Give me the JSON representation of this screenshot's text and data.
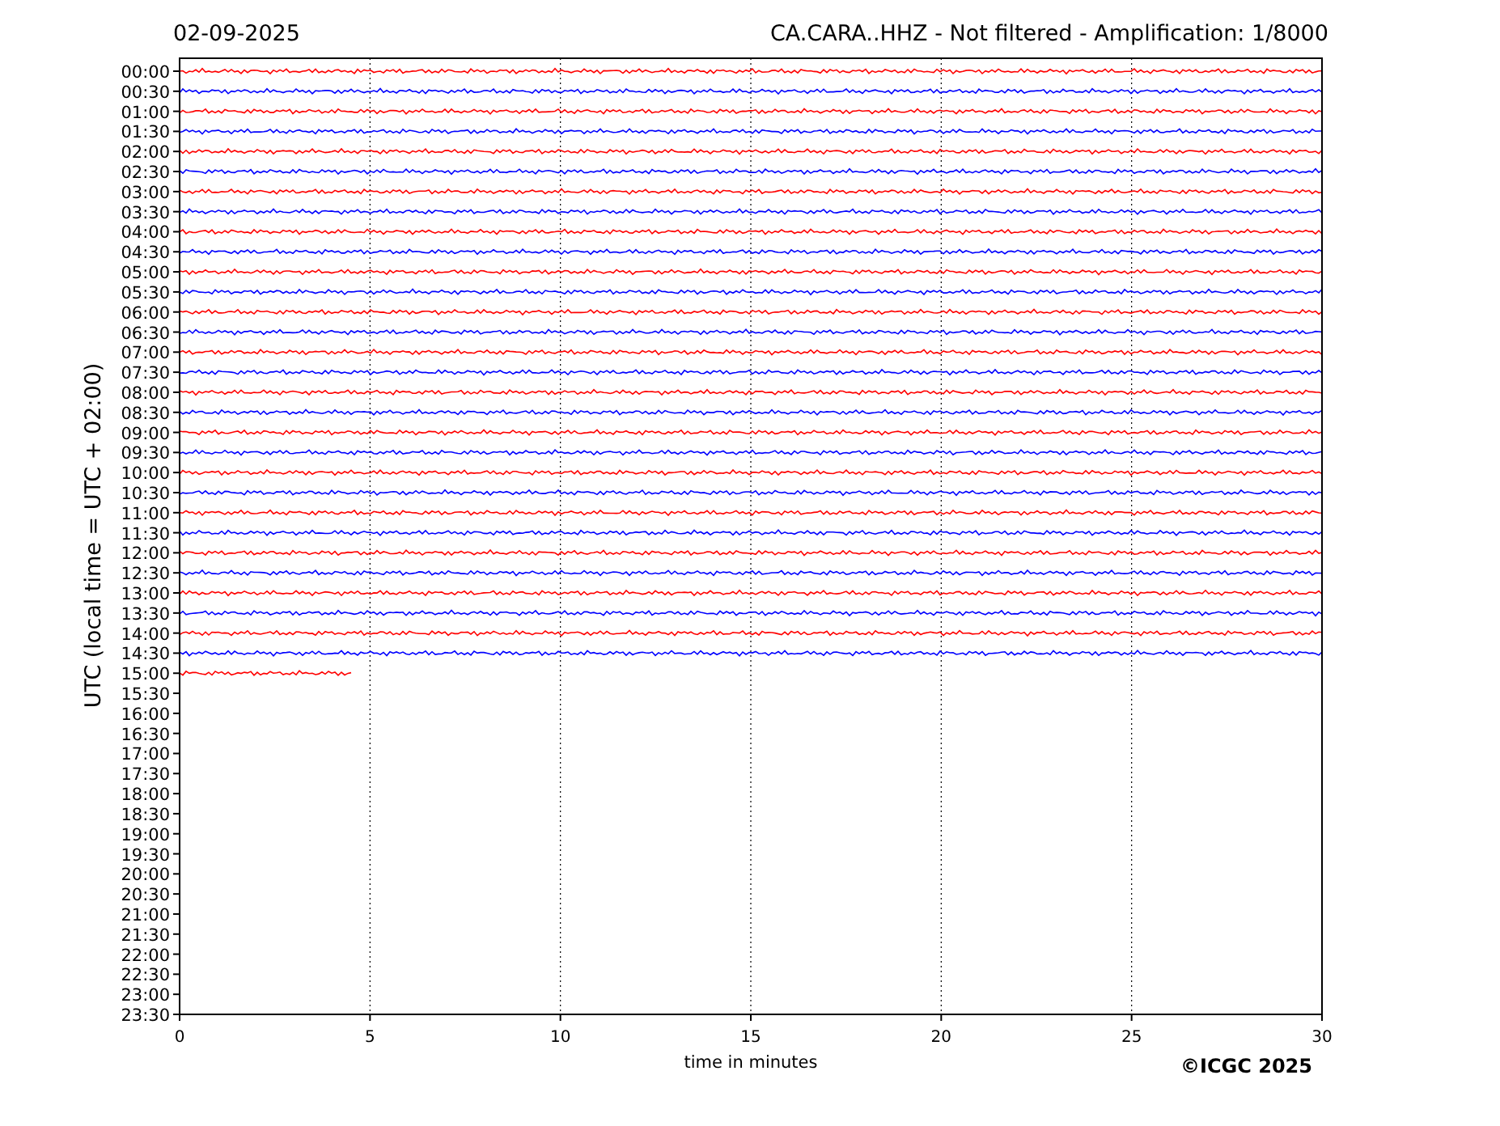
{
  "header": {
    "date": "02-09-2025",
    "title": "CA.CARA..HHZ - Not filtered - Amplification: 1/8000"
  },
  "y_axis": {
    "label": "UTC (local time = UTC + 02:00)"
  },
  "rows": [
    {
      "time": "00:00",
      "trace": {
        "color": "#ff0000",
        "level": 1
      }
    },
    {
      "time": "00:30",
      "trace": {
        "color": "#0000ff",
        "level": 1
      }
    },
    {
      "time": "01:00",
      "trace": {
        "color": "#ff0000",
        "level": 1
      }
    },
    {
      "time": "01:30",
      "trace": {
        "color": "#0000ff",
        "level": 1
      }
    },
    {
      "time": "02:00",
      "trace": {
        "color": "#ff0000",
        "level": 1
      }
    },
    {
      "time": "02:30",
      "trace": {
        "color": "#0000ff",
        "level": 1
      }
    },
    {
      "time": "03:00",
      "trace": {
        "color": "#ff0000",
        "level": 1
      }
    },
    {
      "time": "03:30",
      "trace": {
        "color": "#0000ff",
        "level": 1
      }
    },
    {
      "time": "04:00",
      "trace": {
        "color": "#ff0000",
        "level": 1
      }
    },
    {
      "time": "04:30",
      "trace": {
        "color": "#0000ff",
        "level": 1
      }
    },
    {
      "time": "05:00",
      "trace": {
        "color": "#ff0000",
        "level": 1
      }
    },
    {
      "time": "05:30",
      "trace": {
        "color": "#0000ff",
        "level": 1
      }
    },
    {
      "time": "06:00",
      "trace": {
        "color": "#ff0000",
        "level": 1
      }
    },
    {
      "time": "06:30",
      "trace": {
        "color": "#0000ff",
        "level": 1
      }
    },
    {
      "time": "07:00",
      "trace": {
        "color": "#ff0000",
        "level": 1
      }
    },
    {
      "time": "07:30",
      "trace": {
        "color": "#0000ff",
        "level": 1
      }
    },
    {
      "time": "08:00",
      "trace": {
        "color": "#ff0000",
        "level": 1
      }
    },
    {
      "time": "08:30",
      "trace": {
        "color": "#0000ff",
        "level": 1
      }
    },
    {
      "time": "09:00",
      "trace": {
        "color": "#ff0000",
        "level": 1
      }
    },
    {
      "time": "09:30",
      "trace": {
        "color": "#0000ff",
        "level": 1
      }
    },
    {
      "time": "10:00",
      "trace": {
        "color": "#ff0000",
        "level": 1
      }
    },
    {
      "time": "10:30",
      "trace": {
        "color": "#0000ff",
        "level": 1
      }
    },
    {
      "time": "11:00",
      "trace": {
        "color": "#ff0000",
        "level": 1
      }
    },
    {
      "time": "11:30",
      "trace": {
        "color": "#0000ff",
        "level": 1
      }
    },
    {
      "time": "12:00",
      "trace": {
        "color": "#ff0000",
        "level": 1
      }
    },
    {
      "time": "12:30",
      "trace": {
        "color": "#0000ff",
        "level": 1
      }
    },
    {
      "time": "13:00",
      "trace": {
        "color": "#ff0000",
        "level": 1
      }
    },
    {
      "time": "13:30",
      "trace": {
        "color": "#0000ff",
        "level": 1
      }
    },
    {
      "time": "14:00",
      "trace": {
        "color": "#ff0000",
        "level": 1
      }
    },
    {
      "time": "14:30",
      "trace": {
        "color": "#0000ff",
        "level": 1
      }
    },
    {
      "time": "15:00",
      "trace": {
        "color": "#ff0000",
        "level": 0.152
      }
    },
    {
      "time": "15:30"
    },
    {
      "time": "16:00"
    },
    {
      "time": "16:30"
    },
    {
      "time": "17:00"
    },
    {
      "time": "17:30"
    },
    {
      "time": "18:00"
    },
    {
      "time": "18:30"
    },
    {
      "time": "19:00"
    },
    {
      "time": "19:30"
    },
    {
      "time": "20:00"
    },
    {
      "time": "20:30"
    },
    {
      "time": "21:00"
    },
    {
      "time": "21:30"
    },
    {
      "time": "22:00"
    },
    {
      "time": "22:30"
    },
    {
      "time": "23:00"
    },
    {
      "time": "23:30"
    }
  ],
  "x_axis": {
    "label": "time in minutes",
    "ticks": [
      "0",
      "5",
      "10",
      "15",
      "20",
      "25",
      "30"
    ]
  },
  "copyright": "©ICGC 2025"
}
